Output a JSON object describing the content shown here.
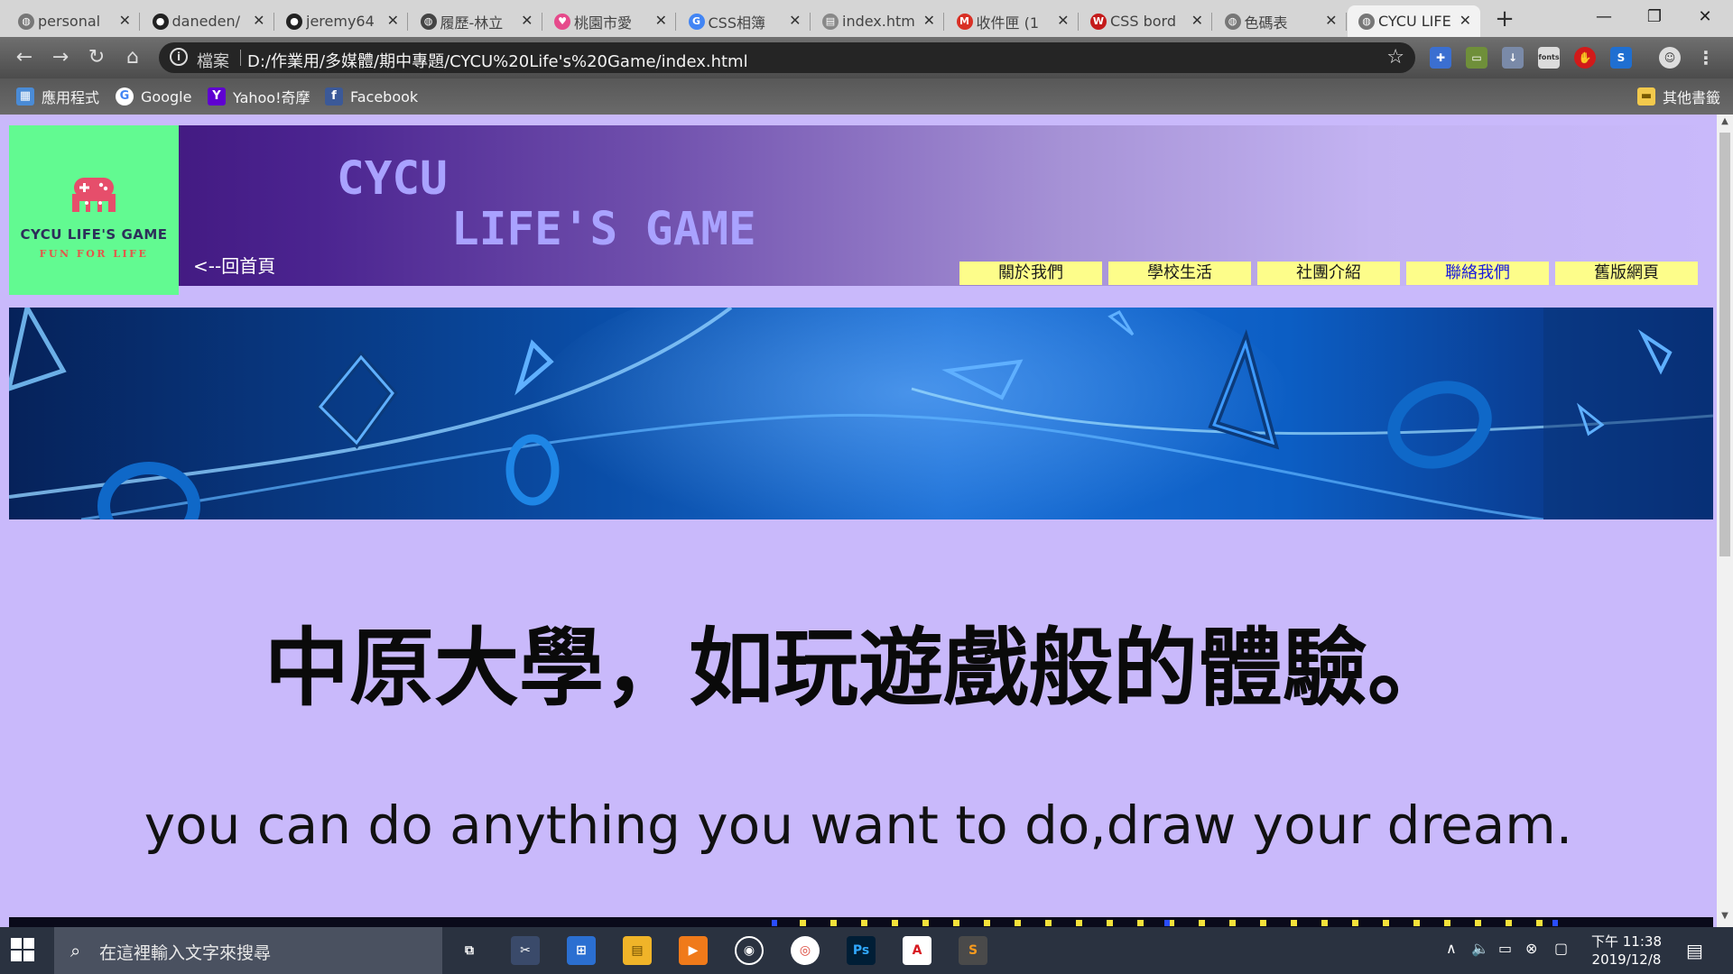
{
  "browser": {
    "tabs": [
      {
        "label": "personal",
        "icon": "globe-icon",
        "color": "#777777"
      },
      {
        "label": "daneden/",
        "icon": "github-icon",
        "color": "#222222"
      },
      {
        "label": "jeremy64",
        "icon": "github-icon",
        "color": "#222222"
      },
      {
        "label": "履歷-林立",
        "icon": "globe-icon",
        "color": "#444444"
      },
      {
        "label": "桃園市愛",
        "icon": "heart-icon",
        "color": "#e64a8b"
      },
      {
        "label": "CSS相簿",
        "icon": "google-icon",
        "color": "#4285f4"
      },
      {
        "label": "index.htm",
        "icon": "file-icon",
        "color": "#888888"
      },
      {
        "label": "收件匣 (1",
        "icon": "gmail-icon",
        "color": "#d93025"
      },
      {
        "label": "CSS bord",
        "icon": "w3-icon",
        "color": "#c41b1b"
      },
      {
        "label": "色碼表",
        "icon": "globe-icon",
        "color": "#777777"
      },
      {
        "label": "CYCU LIFE",
        "icon": "globe-icon",
        "color": "#777777",
        "active": true
      }
    ],
    "new_tab": "+",
    "window_controls": {
      "minimize": "—",
      "maximize": "❐",
      "close": "✕"
    },
    "address": {
      "scheme_label": "檔案",
      "url": "D:/作業用/多媒體/期中專題/CYCU%20Life's%20Game/index.html"
    },
    "bookmarks": [
      {
        "label": "應用程式",
        "icon": "apps-icon"
      },
      {
        "label": "Google",
        "icon": "google-icon"
      },
      {
        "label": "Yahoo!奇摩",
        "icon": "yahoo-icon"
      },
      {
        "label": "Facebook",
        "icon": "facebook-icon"
      }
    ],
    "other_bookmarks": "其他書籤"
  },
  "page": {
    "logo": {
      "name": "CYCU LIFE'S GAME",
      "tagline": "FUN FOR LIFE"
    },
    "title_line1": "CYCU",
    "title_line2": "LIFE'S GAME",
    "home_link": "<--回首頁",
    "nav": [
      {
        "label": "關於我們",
        "color": "#1a1a1a"
      },
      {
        "label": "學校生活",
        "color": "#1a1a1a"
      },
      {
        "label": "社團介紹",
        "color": "#1a1a1a"
      },
      {
        "label": "聯絡我們",
        "color": "#1a1add"
      },
      {
        "label": "舊版網頁",
        "color": "#1a1a1a"
      }
    ],
    "headline": "中原大學，如玩遊戲般的體驗。",
    "subline": "you can do anything you want to do,draw your dream."
  },
  "taskbar": {
    "search_placeholder": "在這裡輸入文字來搜尋",
    "apps": [
      "task-view-icon",
      "snip-icon",
      "store-icon",
      "explorer-icon",
      "media-player-icon",
      "groove-icon",
      "chrome-icon",
      "photoshop-icon",
      "acrobat-icon",
      "sublime-icon"
    ],
    "clock_time": "下午 11:38",
    "clock_date": "2019/12/8"
  },
  "colors": {
    "page_bg": "#c9b9fb",
    "logo_bg": "#62fa91",
    "title": "#a9a2ff",
    "nav_bg": "#fdfd8a"
  }
}
